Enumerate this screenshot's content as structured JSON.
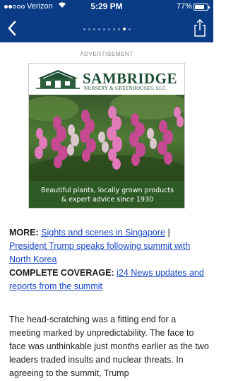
{
  "status_bar": {
    "carrier": "Verizon",
    "time": "5:29 PM",
    "battery": "77%",
    "battery_level": 0.77,
    "signal_bars": 2
  },
  "nav": {
    "back_icon": "chevron-left-icon",
    "share_icon": "share-icon",
    "page_dot_count": 10,
    "active_page_index": 8
  },
  "ad": {
    "label": "ADVERTISEMENT",
    "brand": "SAMBRIDGE",
    "brand_subtitle": "NURSERY & GREENHOUSES, LLC",
    "tagline_line1": "Beautiful plants, locally grown products",
    "tagline_line2": "& expert advice since 1930"
  },
  "more": {
    "more_label": "MORE:",
    "link1": "Sights and scenes in Singapore",
    "separator": " | ",
    "link2": "President Trump speaks following summit with North Korea",
    "coverage_label": "COMPLETE COVERAGE:",
    "link3": "i24 News updates and reports from the summit"
  },
  "article": {
    "paragraph": "The head-scratching was a fitting end for a meeting marked by unpredictability. The face to face was unthinkable just months earlier as the two leaders traded insults and nuclear threats. In agreeing to the summit, Trump"
  },
  "colors": {
    "header": "#0a3c86",
    "link": "#1849c7",
    "ad_green": "#2e5a26",
    "brand_green": "#1d4e33"
  }
}
